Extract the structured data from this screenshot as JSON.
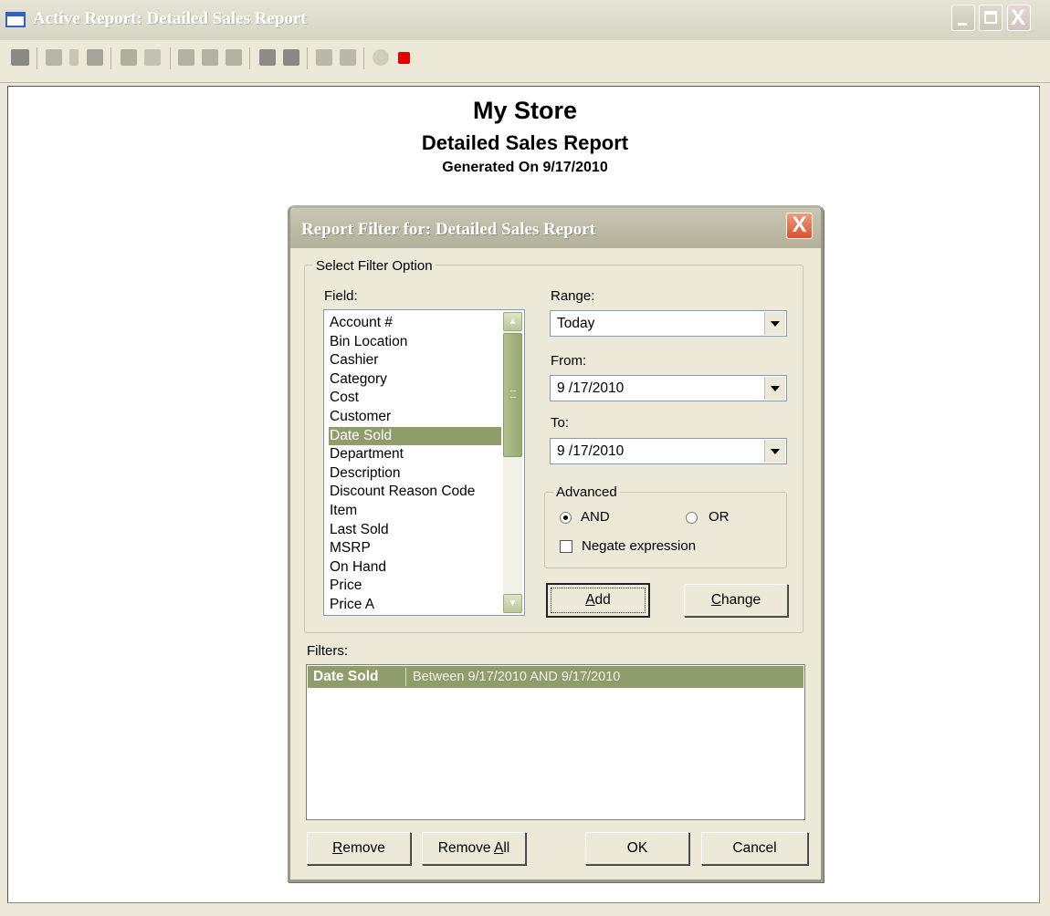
{
  "window": {
    "title": "Active Report:  Detailed Sales Report",
    "close_glyph": "X"
  },
  "report": {
    "store_name": "My Store",
    "report_name": "Detailed Sales Report",
    "generated": "Generated On 9/17/2010"
  },
  "dialog": {
    "title": "Report Filter for: Detailed Sales Report",
    "close_glyph": "X",
    "group_label": "Select Filter Option",
    "field_label": "Field:",
    "fields": [
      "Account #",
      "Bin Location",
      "Cashier",
      "Category",
      "Cost",
      "Customer",
      "Date Sold",
      "Department",
      "Description",
      "Discount Reason Code",
      "Item",
      "Last Sold",
      "MSRP",
      "On Hand",
      "Price",
      "Price A"
    ],
    "selected_field": "Date Sold",
    "range_label": "Range:",
    "range_value": "Today",
    "from_label": "From:",
    "from_value": "9 /17/2010",
    "to_label": "To:",
    "to_value": "9 /17/2010",
    "advanced_label": "Advanced",
    "and_label": "AND",
    "or_label": "OR",
    "and_selected": true,
    "negate_label": "Negate expression",
    "negate_checked": false,
    "add_mnemonic": "A",
    "add_rest": "dd",
    "change_mnemonic": "C",
    "change_rest": "hange",
    "filters_label": "Filters:",
    "filters": [
      {
        "field": "Date Sold",
        "description": "Between 9/17/2010 AND 9/17/2010"
      }
    ],
    "remove_mnemonic": "R",
    "remove_rest": "emove",
    "remove_all_prefix": "Remove ",
    "remove_all_mnemonic": "A",
    "remove_all_rest": "ll",
    "ok_label": "OK",
    "cancel_label": "Cancel"
  },
  "colors": {
    "selection": "#8f9d6b",
    "close_red": "#d8512f",
    "stop_red": "#e00000"
  },
  "icons": [
    "print-icon",
    "toc-icon",
    "page-split-icon",
    "single-page-icon",
    "multi-page-icon",
    "first-page-icon",
    "prev-page-icon",
    "next-page-icon",
    "stop-icon-gray",
    "save-icon",
    "copy-icon",
    "paste-icon",
    "refresh-icon",
    "stop-icon"
  ]
}
